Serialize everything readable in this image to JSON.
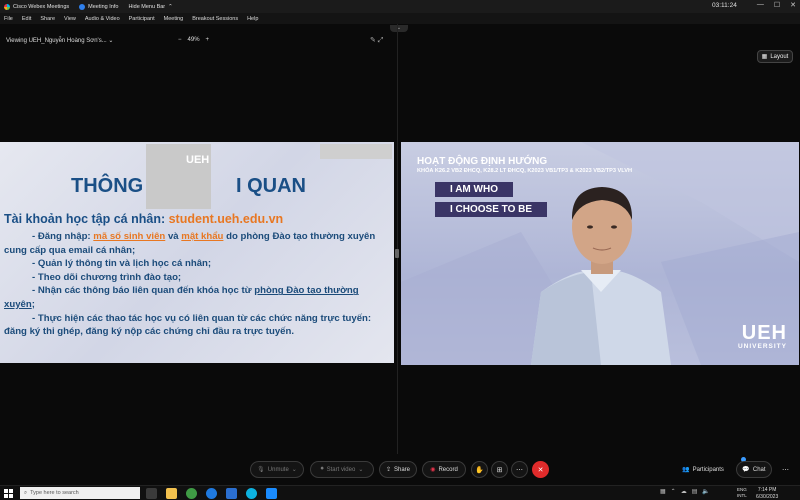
{
  "titlebar": {
    "app_name": "Cisco Webex Meetings",
    "meeting_info": "Meeting Info",
    "hide_menu": "Hide Menu Bar",
    "chevron": "⌃",
    "time": "03:11:24",
    "min": "—",
    "max": "☐",
    "close": "✕"
  },
  "menubar": {
    "items": [
      "File",
      "Edit",
      "Share",
      "View",
      "Audio & Video",
      "Participant",
      "Meeting",
      "Breakout Sessions",
      "Help"
    ]
  },
  "viewbar": {
    "viewing": "Viewing UEH_Nguyễn Hoàng Sơn's...",
    "zoom_out": "−",
    "zoom_level": "49%",
    "zoom_in": "+"
  },
  "layout_label": "Layout",
  "slide": {
    "ueh": "UEH",
    "title_left": "THÔNG",
    "title_right": "I QUAN",
    "heading_a": "Tài khoản học tập cá nhân: ",
    "heading_url": "student.ueh.edu.vn",
    "lines": {
      "l1a": "- Đăng nhập: ",
      "l1b": "mã số sinh viên",
      "l1c": " và ",
      "l1d": "mật khẩu",
      "l1e": " do phòng Đào tạo thường xuyên",
      "l2": "cung cấp qua email cá nhân;",
      "l3": "- Quản lý thông tin và lịch học cá nhân;",
      "l4": "- Theo dõi chương trình đào tạo;",
      "l5a": "- Nhận các thông báo liên quan đến khóa học từ ",
      "l5b": "phòng Đào tạo thường",
      "l6a": "xuyên",
      "l6b": ";",
      "l7": "- Thực hiện các thao tác học vụ có liên quan từ các chức năng trực tuyến:",
      "l8": "đăng ký thi ghép, đăng ký nộp các chứng chỉ đầu ra trực tuyến."
    }
  },
  "video": {
    "title": "HOẠT ĐỘNG ĐỊNH HƯỚNG",
    "subtitle": "KHÓA K26.2 VB2 ĐHCQ, K28.2 LT ĐHCQ, K2023 VB1/TP3 & K2023 VB2/TP3 VLVH",
    "tag1": "I AM WHO",
    "tag2": "I CHOOSE TO BE",
    "logo": "UEH",
    "logo_sub": "UNIVERSITY"
  },
  "controls": {
    "unmute": "Unmute",
    "start_video": "Start video",
    "share": "Share",
    "record": "Record",
    "participants": "Participants",
    "chat": "Chat"
  },
  "taskbar": {
    "search_placeholder": "Type here to search",
    "lang1": "ENG",
    "lang2": "INTL",
    "time": "7:14 PM",
    "date": "6/30/2023"
  }
}
